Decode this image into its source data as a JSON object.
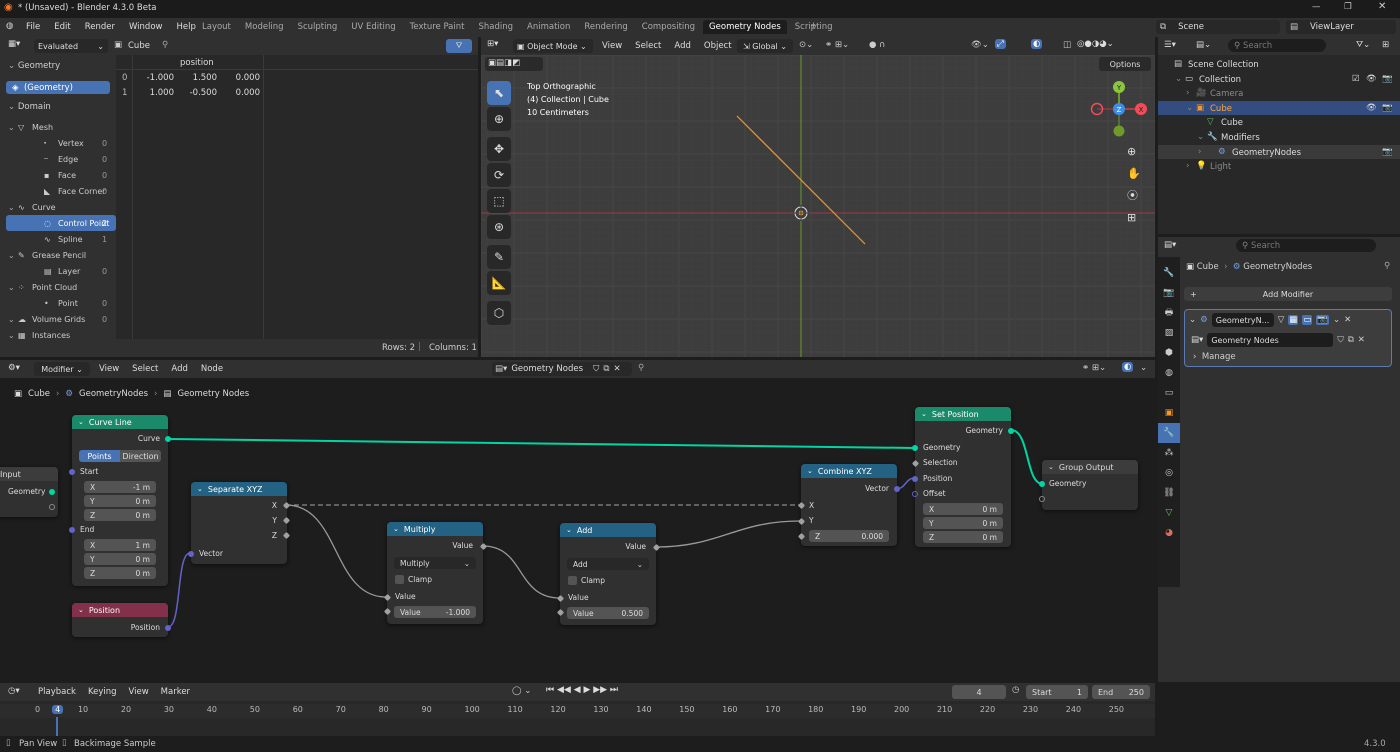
{
  "titlebar": {
    "title": "* (Unsaved) - Blender 4.3.0 Beta"
  },
  "menu": [
    "File",
    "Edit",
    "Render",
    "Window",
    "Help"
  ],
  "workspaces": [
    "Layout",
    "Modeling",
    "Sculpting",
    "UV Editing",
    "Texture Paint",
    "Shading",
    "Animation",
    "Rendering",
    "Compositing",
    "Geometry Nodes",
    "Scripting"
  ],
  "workspace_active": "Geometry Nodes",
  "scene": {
    "label": "Scene",
    "viewlayer": "ViewLayer"
  },
  "spreadsheet": {
    "mode": "Evaluated",
    "object": "Cube",
    "col_header": "position",
    "rows": [
      {
        "i": "0",
        "x": "-1.000",
        "y": "1.500",
        "z": "0.000"
      },
      {
        "i": "1",
        "x": "1.000",
        "y": "-0.500",
        "z": "0.000"
      }
    ],
    "geometry_label": "Geometry",
    "geometry_item": "(Geometry)",
    "domain_label": "Domain",
    "tree": [
      {
        "label": "Mesh",
        "indent": 0,
        "count": ""
      },
      {
        "label": "Vertex",
        "indent": 1,
        "count": "0"
      },
      {
        "label": "Edge",
        "indent": 1,
        "count": "0"
      },
      {
        "label": "Face",
        "indent": 1,
        "count": "0"
      },
      {
        "label": "Face Corner",
        "indent": 1,
        "count": "0"
      },
      {
        "label": "Curve",
        "indent": 0,
        "count": ""
      },
      {
        "label": "Control Point",
        "indent": 1,
        "count": "2"
      },
      {
        "label": "Spline",
        "indent": 1,
        "count": "1"
      },
      {
        "label": "Grease Pencil",
        "indent": 0,
        "count": ""
      },
      {
        "label": "Layer",
        "indent": 1,
        "count": "0"
      },
      {
        "label": "Point Cloud",
        "indent": 0,
        "count": ""
      },
      {
        "label": "Point",
        "indent": 1,
        "count": "0"
      },
      {
        "label": "Volume Grids",
        "indent": 0,
        "count": "0"
      },
      {
        "label": "Instances",
        "indent": 0,
        "count": ""
      }
    ],
    "footer_rows": "Rows: 2",
    "footer_cols": "Columns: 1"
  },
  "viewport": {
    "mode": "Object Mode",
    "menus": [
      "View",
      "Select",
      "Add",
      "Object"
    ],
    "transform": "Global",
    "info1": "Top Orthographic",
    "info2": "(4) Collection | Cube",
    "info3": "10 Centimeters",
    "options": "Options",
    "axes": {
      "y": "Y",
      "x": "X",
      "z": "Z"
    }
  },
  "outliner": {
    "search": "Search",
    "items": [
      {
        "label": "Scene Collection",
        "indent": 0
      },
      {
        "label": "Collection",
        "indent": 1
      },
      {
        "label": "Camera",
        "indent": 2
      },
      {
        "label": "Cube",
        "indent": 2
      },
      {
        "label": "Cube",
        "indent": 3
      },
      {
        "label": "Modifiers",
        "indent": 3
      },
      {
        "label": "GeometryNodes",
        "indent": 4
      },
      {
        "label": "Light",
        "indent": 2
      }
    ]
  },
  "properties": {
    "search": "Search",
    "breadcrumb_obj": "Cube",
    "breadcrumb_mod": "GeometryNodes",
    "add_modifier": "Add Modifier",
    "mod_name": "GeometryN...",
    "node_group": "Geometry Nodes",
    "manage": "Manage"
  },
  "node_editor": {
    "mode": "Modifier",
    "menus": [
      "View",
      "Select",
      "Add",
      "Node"
    ],
    "tree_name": "Geometry Nodes",
    "breadcrumb": [
      "Cube",
      "GeometryNodes",
      "Geometry Nodes"
    ],
    "nodes": {
      "group_input": {
        "title": "Input",
        "out": "Geometry"
      },
      "curve_line": {
        "title": "Curve Line",
        "out": "Curve",
        "tab1": "Points",
        "tab2": "Direction",
        "start": "Start",
        "end": "End",
        "sx": "-1 m",
        "sy": "0 m",
        "sz": "0 m",
        "ex": "1 m",
        "ey": "0 m",
        "ez": "0 m"
      },
      "position": {
        "title": "Position",
        "out": "Position"
      },
      "separate": {
        "title": "Separate XYZ",
        "x": "X",
        "y": "Y",
        "z": "Z",
        "in": "Vector"
      },
      "multiply": {
        "title": "Multiply",
        "out": "Value",
        "op": "Multiply",
        "clamp": "Clamp",
        "in": "Value",
        "val_label": "Value",
        "val": "-1.000"
      },
      "add": {
        "title": "Add",
        "out": "Value",
        "op": "Add",
        "clamp": "Clamp",
        "in": "Value",
        "val_label": "Value",
        "val": "0.500"
      },
      "combine": {
        "title": "Combine XYZ",
        "out": "Vector",
        "x": "X",
        "y": "Y",
        "z": "Z",
        "zval": "0.000"
      },
      "set_position": {
        "title": "Set Position",
        "out": "Geometry",
        "geo": "Geometry",
        "sel": "Selection",
        "pos": "Position",
        "off": "Offset",
        "ox": "0 m",
        "oy": "0 m",
        "oz": "0 m"
      },
      "group_output": {
        "title": "Group Output",
        "in": "Geometry"
      }
    }
  },
  "timeline": {
    "menus": [
      "Playback",
      "Keying",
      "View",
      "Marker"
    ],
    "frame": "4",
    "start_label": "Start",
    "start": "1",
    "end_label": "End",
    "end": "250",
    "ticks": [
      "0",
      "4",
      "10",
      "20",
      "30",
      "40",
      "50",
      "60",
      "70",
      "80",
      "90",
      "100",
      "110",
      "120",
      "130",
      "140",
      "150",
      "160",
      "170",
      "180",
      "190",
      "200",
      "210",
      "220",
      "230",
      "240",
      "250"
    ]
  },
  "statusbar": {
    "left1": "Pan View",
    "left2": "Backimage Sample",
    "version": "4.3.0"
  },
  "colors": {
    "geometry_header": "#1b8a6b",
    "input_header": "#83314a",
    "converter_header": "#246283",
    "active_blue": "#4772b3",
    "curve_orange": "#f5972b"
  }
}
